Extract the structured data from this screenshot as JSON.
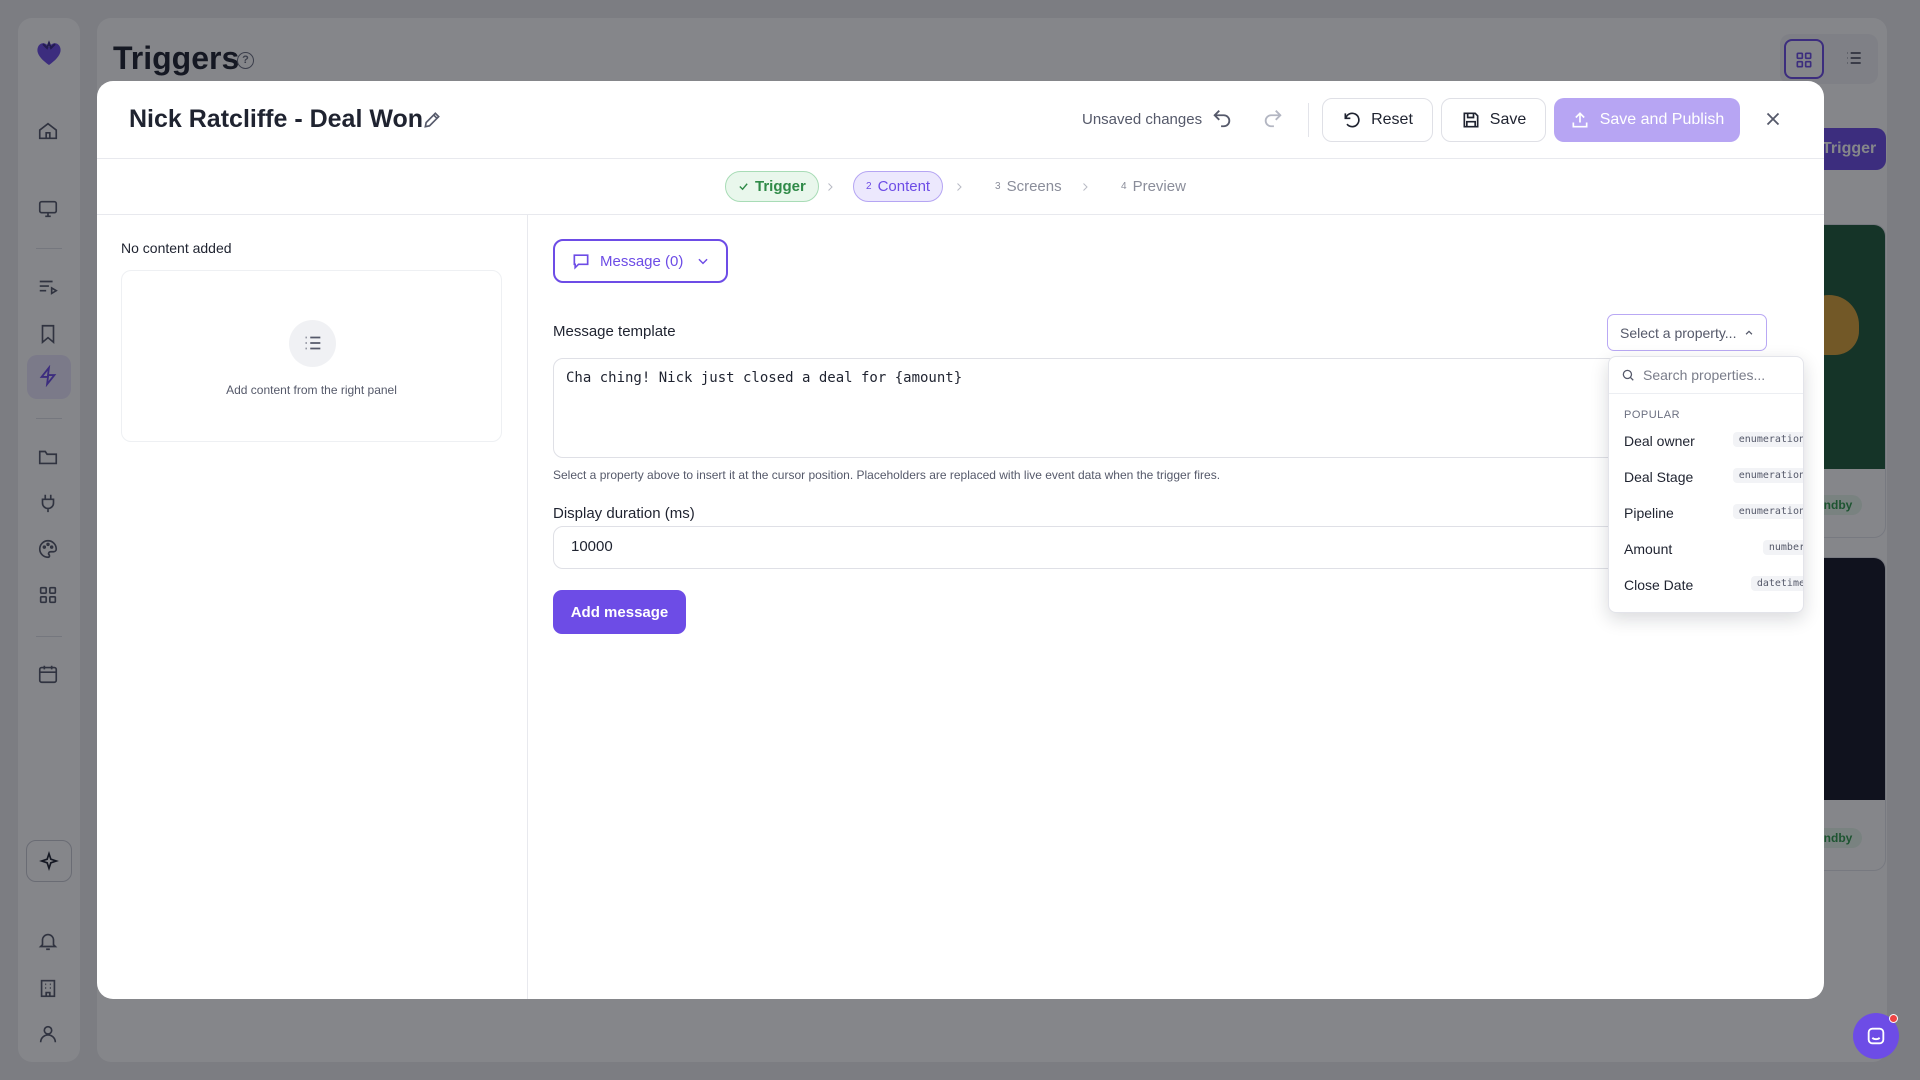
{
  "app": {
    "page_title": "Triggers",
    "new_trigger_label": "Trigger",
    "card_status": "tandby"
  },
  "modal": {
    "title": "Nick Ratcliffe - Deal Won",
    "unsaved_label": "Unsaved changes",
    "reset_label": "Reset",
    "save_label": "Save",
    "publish_label": "Save and Publish"
  },
  "stepper": {
    "steps": [
      {
        "number": "",
        "label": "Trigger",
        "state": "done"
      },
      {
        "number": "2",
        "label": "Content",
        "state": "active"
      },
      {
        "number": "3",
        "label": "Screens",
        "state": "pending"
      },
      {
        "number": "4",
        "label": "Preview",
        "state": "pending"
      }
    ]
  },
  "left_panel": {
    "heading": "No content added",
    "empty_text": "Add content from the right panel"
  },
  "editor": {
    "type_select_label": "Message (0)",
    "template_label": "Message template",
    "property_select_placeholder": "Select a property...",
    "template_value": "Cha ching! Nick just closed a deal for {amount}",
    "helper_text": "Select a property above to insert it at the cursor position. Placeholders are replaced with live event data when the trigger fires.",
    "duration_label": "Display duration (ms)",
    "duration_value": "10000",
    "add_message_label": "Add message"
  },
  "property_dropdown": {
    "search_placeholder": "Search properties...",
    "section_label": "POPULAR",
    "items": [
      {
        "label": "Deal owner",
        "type": "enumeration"
      },
      {
        "label": "Deal Stage",
        "type": "enumeration"
      },
      {
        "label": "Pipeline",
        "type": "enumeration"
      },
      {
        "label": "Amount",
        "type": "number"
      },
      {
        "label": "Close Date",
        "type": "datetime"
      }
    ]
  },
  "colors": {
    "accent": "#6d4ce6",
    "accent_light": "#ece8fd",
    "success": "#2f8a48",
    "overlay": "rgba(12,14,22,0.5)"
  },
  "icons": {
    "logo": "heart-logo-icon",
    "edit": "pencil-icon",
    "undo": "undo-icon",
    "redo": "redo-icon",
    "reset": "rotate-ccw-icon",
    "save": "floppy-disk-icon",
    "publish": "upload-icon",
    "close": "close-icon",
    "message": "chat-bubble-icon",
    "search": "search-icon",
    "list": "list-icon"
  }
}
